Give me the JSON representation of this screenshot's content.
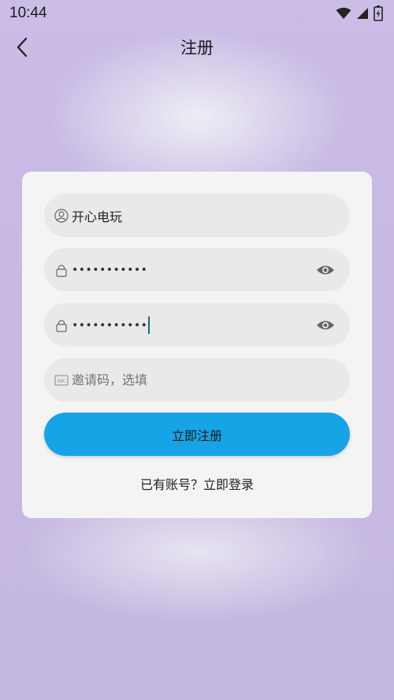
{
  "status_bar": {
    "time": "10:44"
  },
  "nav": {
    "title": "注册"
  },
  "form": {
    "username": {
      "value": "开心电玩"
    },
    "password": {
      "value": "•••••••••••"
    },
    "confirm_password": {
      "value": "•••••••••••"
    },
    "invite_code": {
      "placeholder": "邀请码，选填"
    },
    "submit_label": "立即注册",
    "login_link": "已有账号？立即登录"
  },
  "colors": {
    "accent": "#17a4e6",
    "background": "#c6b9e1",
    "card": "#f4f4f5",
    "field": "#e9e9ea"
  },
  "icons": {
    "back": "chevron-left-icon",
    "user": "user-circle-icon",
    "lock": "lock-icon",
    "eye": "eye-icon",
    "invite": "abc-card-icon"
  }
}
